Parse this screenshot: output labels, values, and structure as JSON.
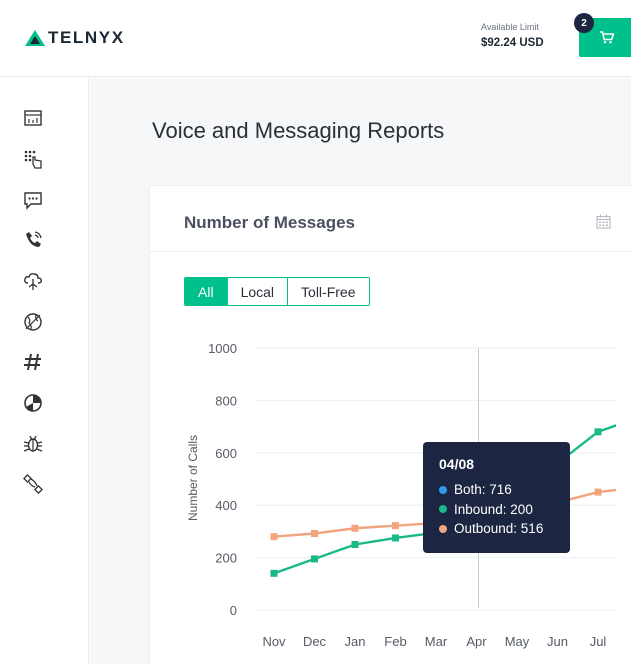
{
  "header": {
    "brand": "TELNYX",
    "limit_label": "Available Limit",
    "limit_value": "$92.24 USD",
    "cart_badge": "2",
    "brand_color": "#00c08b"
  },
  "sidebar": {
    "items": [
      {
        "icon": "dashboard-icon"
      },
      {
        "icon": "dialpad-touch-icon"
      },
      {
        "icon": "message-icon"
      },
      {
        "icon": "phone-call-icon"
      },
      {
        "icon": "cloud-network-icon"
      },
      {
        "icon": "globe-icon"
      },
      {
        "icon": "hashtag-icon"
      },
      {
        "icon": "pie-chart-icon"
      },
      {
        "icon": "bug-icon"
      },
      {
        "icon": "integrations-icon"
      }
    ]
  },
  "page": {
    "title": "Voice and Messaging Reports"
  },
  "card": {
    "title": "Number of Messages",
    "filters": [
      "All",
      "Local",
      "Toll-Free"
    ],
    "active_filter": "All"
  },
  "tooltip": {
    "title": "04/08",
    "rows": [
      {
        "label": "Both: 716",
        "color": "#2e9bf0"
      },
      {
        "label": "Inbound: 200",
        "color": "#1ab98a"
      },
      {
        "label": "Outbound: 516",
        "color": "#f2a47f"
      }
    ]
  },
  "chart_data": {
    "type": "line",
    "ylabel": "Number of Calls",
    "xlabel": "",
    "categories": [
      "Nov",
      "Dec",
      "Jan",
      "Feb",
      "Mar",
      "Apr",
      "May",
      "Jun",
      "Jul"
    ],
    "ylim": [
      0,
      1000
    ],
    "yticks": [
      0,
      200,
      400,
      600,
      800,
      1000
    ],
    "grid": true,
    "hover_index": 5,
    "series": [
      {
        "name": "Inbound",
        "color": "#1ab98a",
        "values": [
          140,
          195,
          250,
          275,
          295,
          335,
          450,
          560,
          680,
          735
        ]
      },
      {
        "name": "Outbound",
        "color": "#f2a47f",
        "values": [
          280,
          292,
          312,
          322,
          332,
          345,
          368,
          410,
          450,
          468
        ]
      }
    ]
  }
}
